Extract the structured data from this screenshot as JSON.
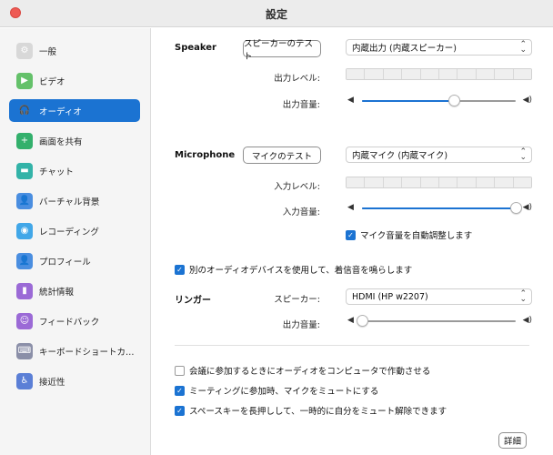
{
  "window": {
    "title": "設定"
  },
  "sidebar": {
    "items": [
      {
        "label": "一般",
        "icon": "gear-icon",
        "color": "#d8d8d8",
        "glyph": "⚙",
        "active": false
      },
      {
        "label": "ビデオ",
        "icon": "video-camera-icon",
        "color": "#64c16a",
        "glyph": "▶",
        "active": false
      },
      {
        "label": "オーディオ",
        "icon": "headphones-icon",
        "color": "#1b73d2",
        "glyph": "🎧",
        "active": true
      },
      {
        "label": "画面を共有",
        "icon": "share-screen-icon",
        "color": "#33b06c",
        "glyph": "+",
        "active": false
      },
      {
        "label": "チャット",
        "icon": "chat-bubble-icon",
        "color": "#33b3a8",
        "glyph": "▬",
        "active": false
      },
      {
        "label": "バーチャル背景",
        "icon": "virtual-background-icon",
        "color": "#4a8ee0",
        "glyph": "👤",
        "active": false
      },
      {
        "label": "レコーディング",
        "icon": "record-icon",
        "color": "#41a7e8",
        "glyph": "◉",
        "active": false
      },
      {
        "label": "プロフィール",
        "icon": "profile-icon",
        "color": "#4a8ee0",
        "glyph": "👤",
        "active": false
      },
      {
        "label": "統計情報",
        "icon": "statistics-icon",
        "color": "#9b6ad6",
        "glyph": "▮",
        "active": false
      },
      {
        "label": "フィードバック",
        "icon": "feedback-icon",
        "color": "#9b6ad6",
        "glyph": "☺",
        "active": false
      },
      {
        "label": "キーボードショートカ…",
        "icon": "keyboard-icon",
        "color": "#8b8fa8",
        "glyph": "⌨",
        "active": false
      },
      {
        "label": "接近性",
        "icon": "accessibility-icon",
        "color": "#5b7fd6",
        "glyph": "♿",
        "active": false
      }
    ]
  },
  "speaker": {
    "section_label": "Speaker",
    "test_button": "スピーカーのテスト",
    "device": "内蔵出力 (内蔵スピーカー)",
    "output_level_label": "出力レベル:",
    "output_volume_label": "出力音量:",
    "volume": 0.6
  },
  "microphone": {
    "section_label": "Microphone",
    "test_button": "マイクのテスト",
    "device": "内蔵マイク (内蔵マイク)",
    "input_level_label": "入力レベル:",
    "input_volume_label": "入力音量:",
    "volume": 1.0,
    "auto_adjust_label": "マイク音量を自動調整します",
    "auto_adjust_checked": true
  },
  "ringer": {
    "separate_device_label": "別のオーディオデバイスを使用して、着信音を鳴らします",
    "separate_device_checked": true,
    "section_label": "リンガー",
    "speaker_label": "スピーカー:",
    "device": "HDMI (HP w2207)",
    "volume_label": "出力音量:",
    "volume": 0.0
  },
  "options": [
    {
      "label": "会議に参加するときにオーディオをコンピュータで作動させる",
      "checked": false
    },
    {
      "label": "ミーティングに参加時、マイクをミュートにする",
      "checked": true
    },
    {
      "label": "スペースキーを長押しして、一時的に自分をミュート解除できます",
      "checked": true
    }
  ],
  "advanced_button": "詳細",
  "colors": {
    "accent": "#1b73d2",
    "close": "#ee5a54"
  }
}
